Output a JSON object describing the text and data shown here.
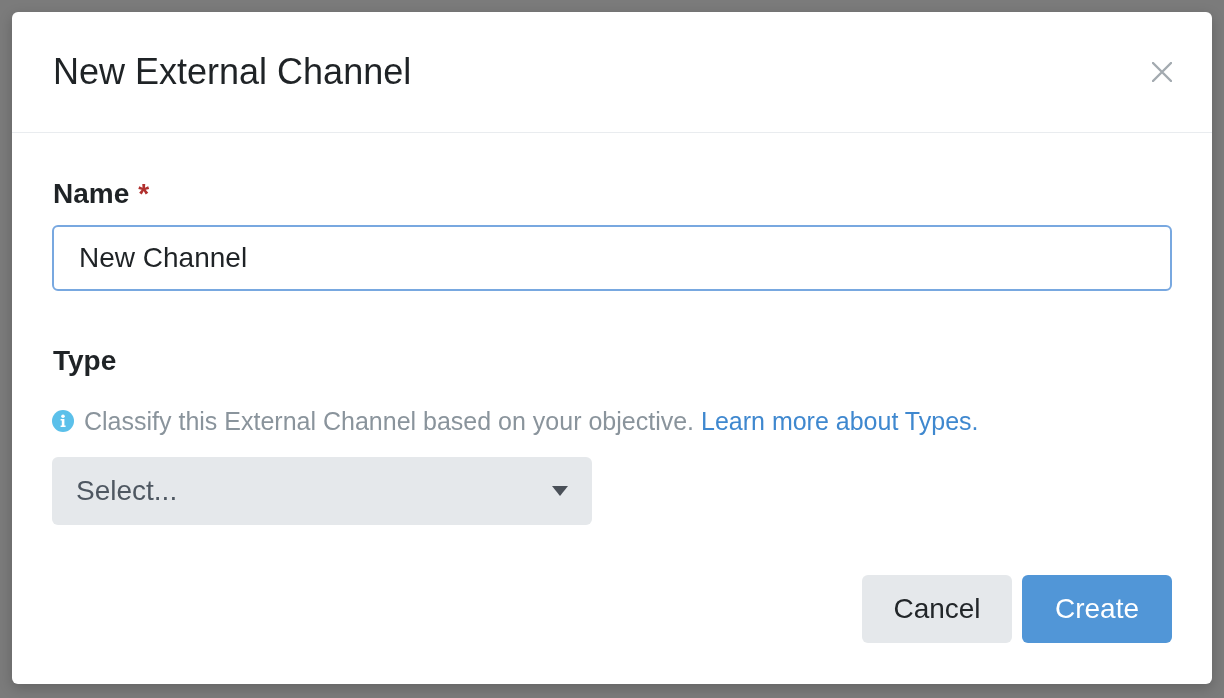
{
  "dialog": {
    "title": "New External Channel",
    "fields": [
      {
        "kind": "text",
        "label": "Name",
        "required_mark": "*",
        "value": "New Channel",
        "focused": true
      },
      {
        "kind": "select",
        "label": "Type",
        "hint": "Classify this External Channel based on your objective.",
        "hint_link": "Learn more about Types.",
        "placeholder": "Select..."
      }
    ],
    "buttons": [
      {
        "label": "Cancel",
        "kind": "secondary"
      },
      {
        "label": "Create",
        "kind": "primary"
      }
    ]
  }
}
